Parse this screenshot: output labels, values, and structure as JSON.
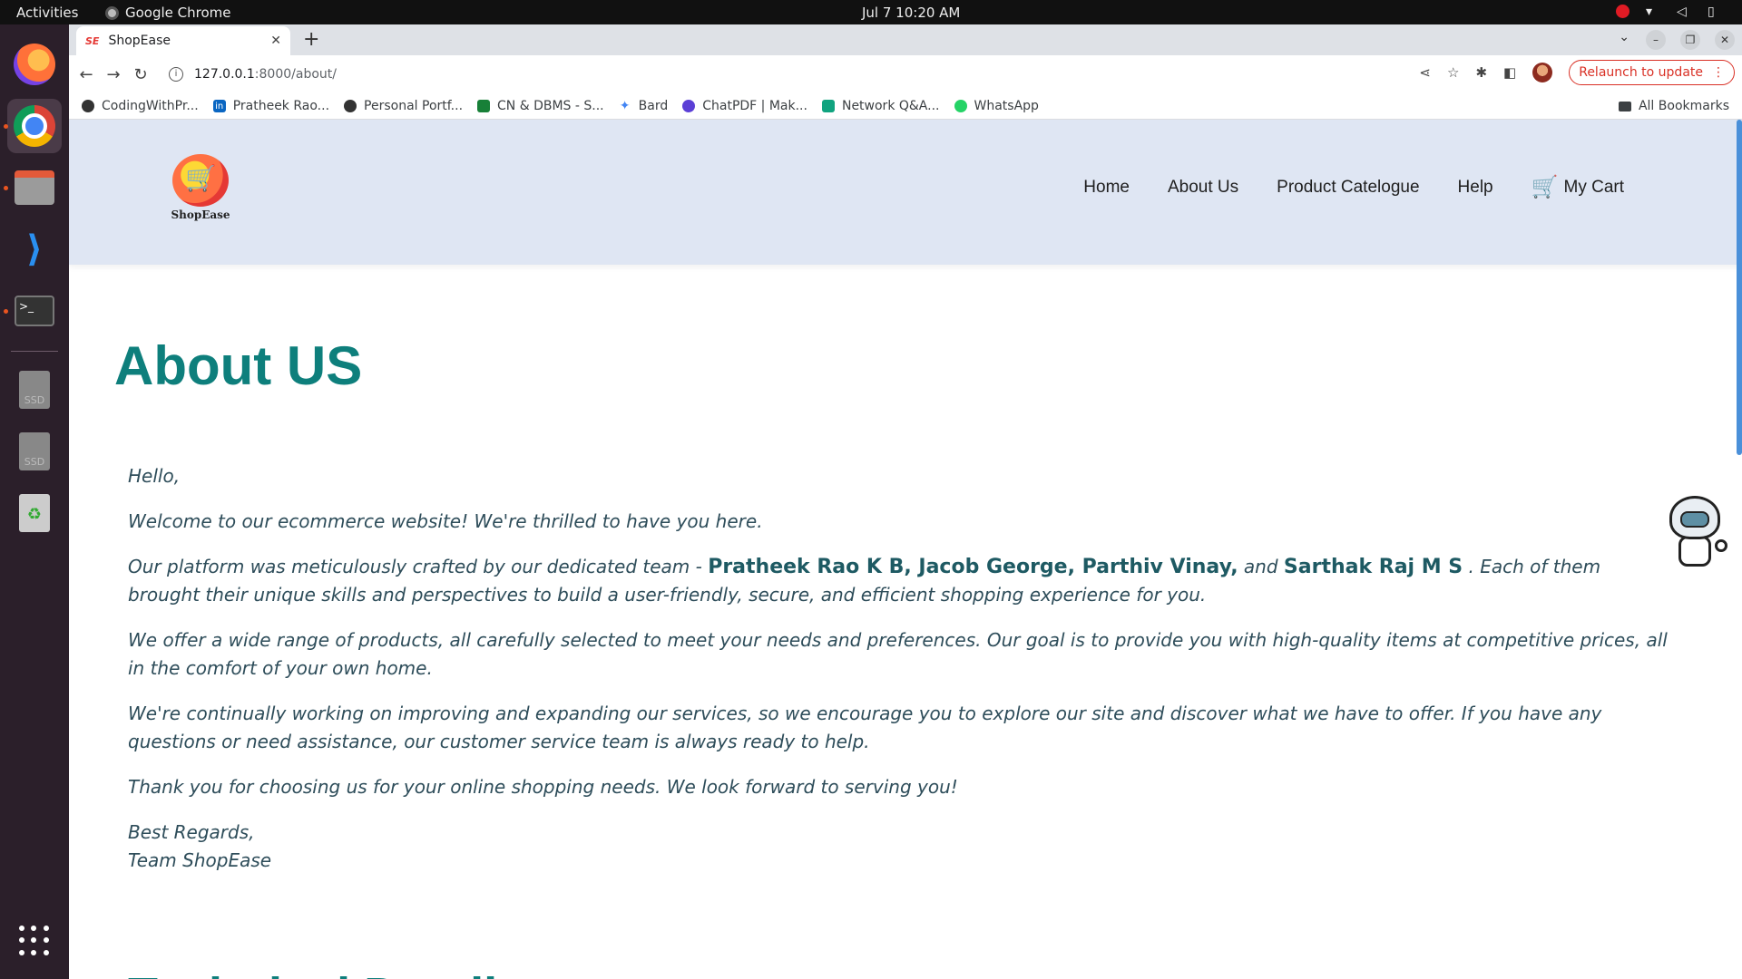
{
  "os": {
    "activities": "Activities",
    "app_name": "Google Chrome",
    "clock": "Jul 7  10:20 AM",
    "dock": [
      "Firefox",
      "Google Chrome",
      "Files",
      "Visual Studio Code",
      "Terminal",
      "SSD",
      "SSD",
      "Trash",
      "Show Applications"
    ],
    "dock_ssd_label": "SSD"
  },
  "browser": {
    "tab_title": "ShopEase",
    "tab_favicon": "SE",
    "url_host": "127.0.0.1",
    "url_path": ":8000/about/",
    "relaunch_label": "Relaunch to update",
    "bookmarks": [
      "CodingWithPr...",
      "Pratheek Rao...",
      "Personal Portf...",
      "CN & DBMS - S...",
      "Bard",
      "ChatPDF | Mak...",
      "Network Q&A...",
      "WhatsApp"
    ],
    "all_bookmarks": "All Bookmarks"
  },
  "site": {
    "logo_text": "ShopEase",
    "nav": {
      "home": "Home",
      "about": "About Us",
      "catalogue": "Product Catelogue",
      "help": "Help",
      "cart": "My Cart"
    },
    "page_title": "About US",
    "greeting": "Hello,",
    "welcome": "Welcome to our ecommerce website! We're thrilled to have you here.",
    "team_intro": "Our platform was meticulously crafted by our dedicated team - ",
    "team_names_1": "Pratheek Rao K B, Jacob George, Parthiv Vinay,",
    "team_and": " and ",
    "team_names_2": "Sarthak Raj M S",
    "team_outro": " . Each of them brought their unique skills and perspectives to build a user-friendly, secure, and efficient shopping experience for you.",
    "offer": "We offer a wide range of products, all carefully selected to meet your needs and preferences. Our goal is to provide you with high-quality items at competitive prices, all in the comfort of your own home.",
    "improving": "We're continually working on improving and expanding our services, so we encourage you to explore our site and discover what we have to offer. If you have any questions or need assistance, our customer service team is always ready to help.",
    "thanks": "Thank you for choosing us for your online shopping needs. We look forward to serving you!",
    "regards": "Best Regards,",
    "signature": "Team ShopEase",
    "tech_title": "Technical Details"
  },
  "colors": {
    "accent_teal": "#0e7f7c",
    "header_bg": "#dfe6f3",
    "relaunch_red": "#d93025"
  }
}
